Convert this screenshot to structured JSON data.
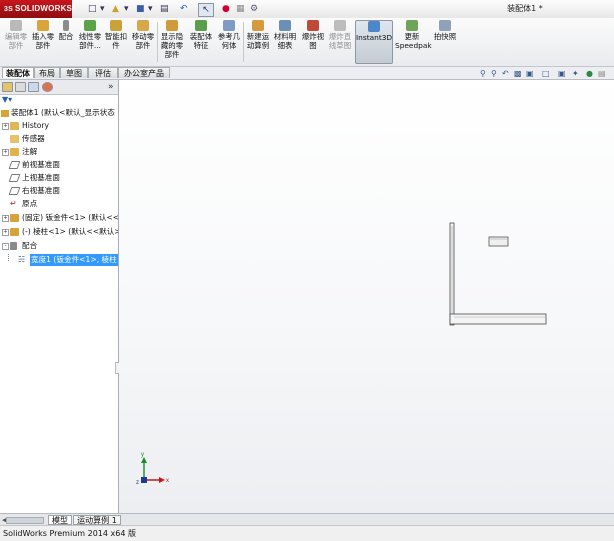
{
  "app": {
    "brand": "SOLIDWORKS",
    "brand_prefix": "3S",
    "document_title": "装配体1 *"
  },
  "command_manager": {
    "items": [
      {
        "label": "编辑零\n部件",
        "icon": "edit-component-icon",
        "enabled": false
      },
      {
        "label": "插入零\n部件",
        "icon": "insert-component-icon",
        "enabled": true
      },
      {
        "label": "配合",
        "icon": "mate-icon",
        "enabled": true
      },
      {
        "label": "线性零\n部件...",
        "icon": "linear-pattern-icon",
        "enabled": true
      },
      {
        "label": "智能扣\n件",
        "icon": "smart-fastener-icon",
        "enabled": true
      },
      {
        "label": "移动零\n部件",
        "icon": "move-component-icon",
        "enabled": true
      },
      {
        "label": "显示隐\n藏的零\n部件",
        "icon": "show-hidden-icon",
        "enabled": true
      },
      {
        "label": "装配体\n特征",
        "icon": "assembly-feature-icon",
        "enabled": true
      },
      {
        "label": "参考几\n何体",
        "icon": "reference-geometry-icon",
        "enabled": true
      },
      {
        "label": "新建运\n动算例",
        "icon": "new-motion-study-icon",
        "enabled": true
      },
      {
        "label": "材料明\n细表",
        "icon": "bom-icon",
        "enabled": true
      },
      {
        "label": "爆炸视\n图",
        "icon": "exploded-view-icon",
        "enabled": true
      },
      {
        "label": "爆炸直\n线草图",
        "icon": "explode-line-sketch-icon",
        "enabled": false
      },
      {
        "label": "Instant3D",
        "icon": "instant3d-icon",
        "enabled": true,
        "active": true
      },
      {
        "label": "更新\nSpeedpak",
        "icon": "speedpak-icon",
        "enabled": true
      },
      {
        "label": "拍快照",
        "icon": "snapshot-icon",
        "enabled": true
      }
    ]
  },
  "tabs": [
    "装配体",
    "布局",
    "草图",
    "评估",
    "办公室产品"
  ],
  "feature_manager": {
    "root": "装配体1 (默认<默认_显示状态",
    "items": [
      {
        "label": "History",
        "icon": "history-icon",
        "expander": "+"
      },
      {
        "label": "传感器",
        "icon": "sensor-icon",
        "expander": ""
      },
      {
        "label": "注解",
        "icon": "annotation-icon",
        "expander": "+"
      },
      {
        "label": "前视基准面",
        "icon": "plane-icon",
        "expander": ""
      },
      {
        "label": "上视基准面",
        "icon": "plane-icon",
        "expander": ""
      },
      {
        "label": "右视基准面",
        "icon": "plane-icon",
        "expander": ""
      },
      {
        "label": "原点",
        "icon": "origin-icon",
        "expander": ""
      },
      {
        "label": "(固定) 钣金件<1> (默认<<",
        "icon": "part-icon",
        "expander": "+"
      },
      {
        "label": "(-) 棱柱<1> (默认<<默认>_",
        "icon": "part-icon",
        "expander": "+"
      },
      {
        "label": "配合",
        "icon": "mates-folder-icon",
        "expander": "-"
      },
      {
        "label": "宽度1 (钣金件<1>, 棱柱",
        "icon": "width-mate-icon",
        "expander": "",
        "selected": true
      }
    ]
  },
  "bottom_tabs": [
    "模型",
    "运动算例 1"
  ],
  "status": {
    "text": "SolidWorks Premium 2014 x64 版"
  },
  "triad": {
    "x": "x",
    "y": "y",
    "z": "z"
  }
}
